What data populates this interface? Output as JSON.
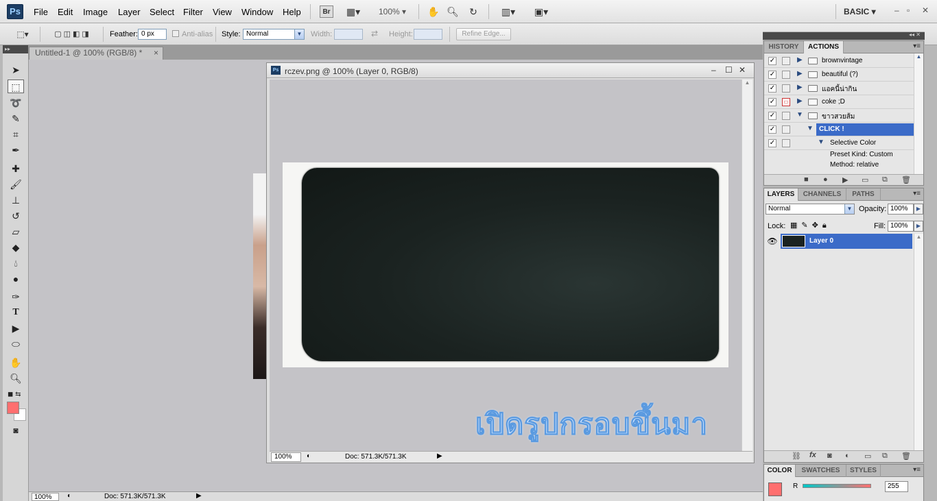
{
  "app": {
    "logo": "Ps",
    "menus": [
      "File",
      "Edit",
      "Image",
      "Layer",
      "Select",
      "Filter",
      "View",
      "Window",
      "Help"
    ],
    "bridge_label": "Br",
    "zoom_menu": "100%",
    "workspace": "BASIC",
    "accent": "#3b6bc8"
  },
  "options": {
    "feather_label": "Feather:",
    "feather_value": "0 px",
    "antialias_label": "Anti-alias",
    "style_label": "Style:",
    "style_value": "Normal",
    "width_label": "Width:",
    "height_label": "Height:",
    "refine_edge": "Refine Edge..."
  },
  "document_tab": {
    "title": "Untitled-1 @ 100% (RGB/8) *",
    "close": "×"
  },
  "main_status": {
    "zoom": "100%",
    "doc": "Doc: 571.3K/571.3K"
  },
  "doc_window": {
    "title": "rczev.png @ 100% (Layer 0, RGB/8)",
    "zoom": "100%",
    "doc": "Doc: 571.3K/571.3K",
    "caption": "เปิดรูปกรอบขึ้นมา"
  },
  "history_panel": {
    "tabs": [
      "HISTORY",
      "ACTIONS"
    ],
    "active_tab": "ACTIONS",
    "actions": [
      {
        "label": "brownvintage"
      },
      {
        "label": "beautiful (?)"
      },
      {
        "label": "แอคนี้น่ากิน"
      },
      {
        "label": "coke ;D"
      },
      {
        "label": "ขาวสวยส้ม"
      },
      {
        "label": "CLICK !"
      },
      {
        "label": "Selective Color"
      },
      {
        "label": "Preset Kind: Custom"
      },
      {
        "label": "Method: relative"
      }
    ]
  },
  "layers_panel": {
    "tabs": [
      "LAYERS",
      "CHANNELS",
      "PATHS"
    ],
    "blend_mode": "Normal",
    "opacity_label": "Opacity:",
    "opacity_value": "100%",
    "lock_label": "Lock:",
    "fill_label": "Fill:",
    "fill_value": "100%",
    "layers": [
      {
        "name": "Layer 0"
      }
    ]
  },
  "color_panel": {
    "tabs": [
      "COLOR",
      "SWATCHES",
      "STYLES"
    ],
    "r_label": "R",
    "r_value": "255",
    "foreground": "#ff6f6f"
  }
}
